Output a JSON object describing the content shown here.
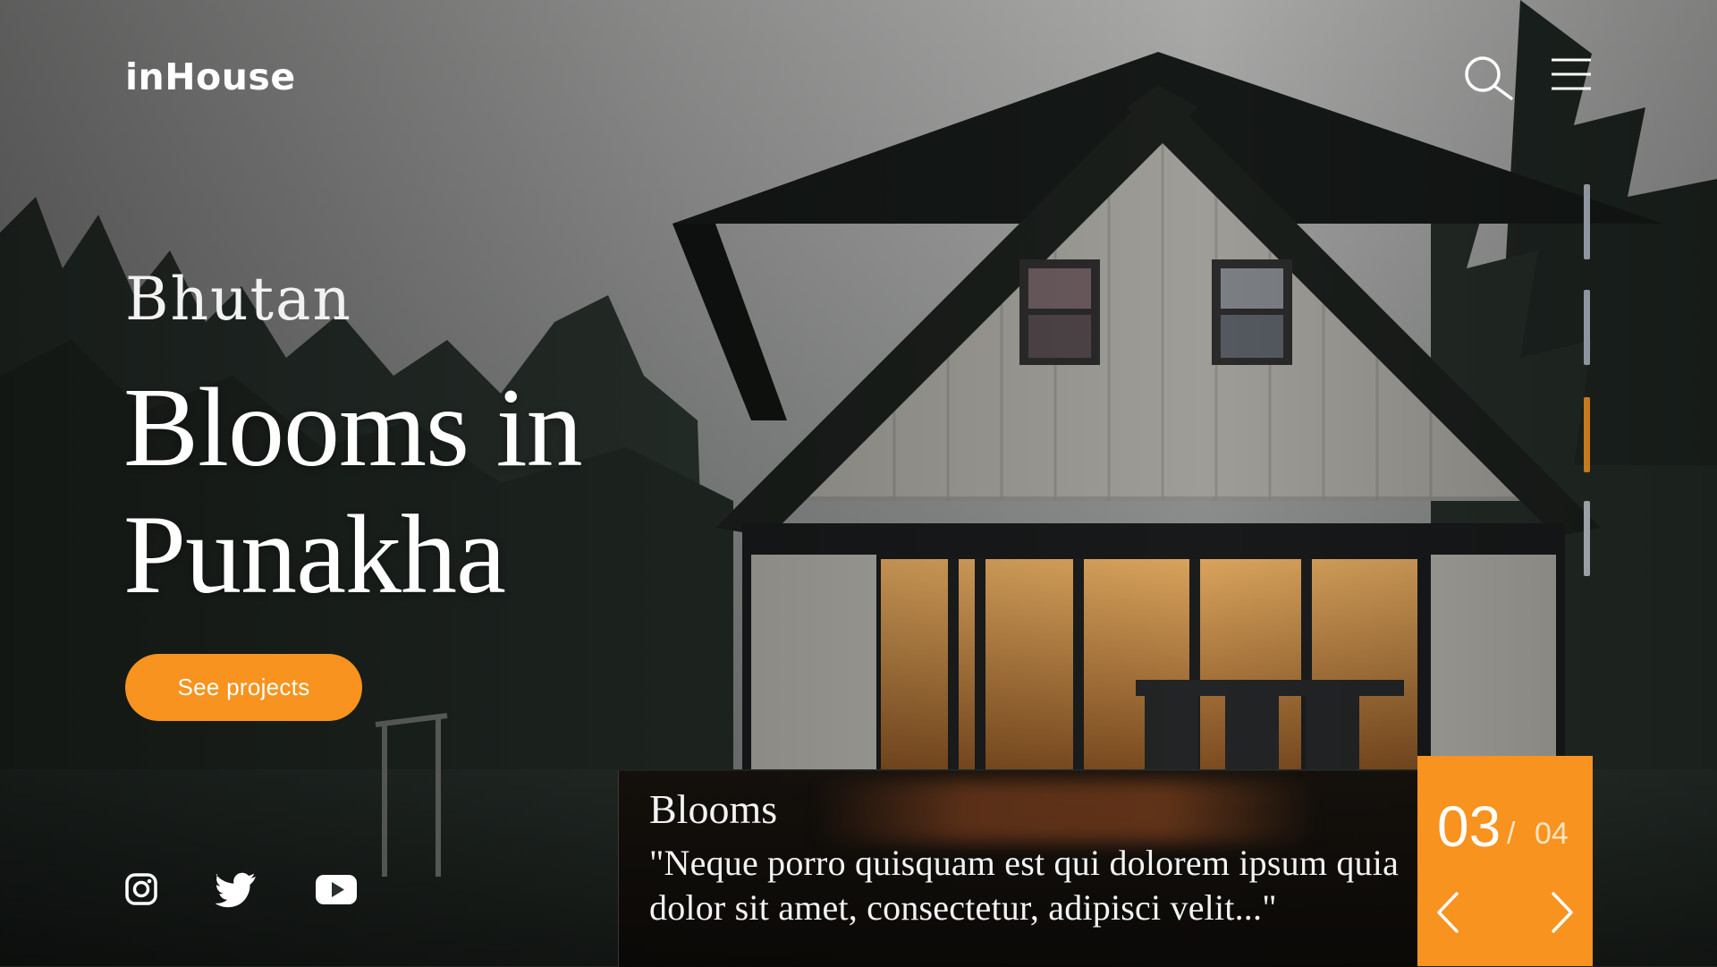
{
  "header": {
    "logo": "inHouse",
    "search_icon": "search-icon",
    "menu_icon": "hamburger-menu-icon"
  },
  "hero": {
    "kicker": "Bhutan",
    "headline_line1": "Blooms in",
    "headline_line2": "Punakha",
    "cta_label": "See projects"
  },
  "slide_indicator": {
    "segments": 4,
    "active_index": 3,
    "active_color": "#c67a1c",
    "inactive_color": "#8f959e"
  },
  "social": {
    "icons": [
      "instagram-icon",
      "twitter-icon",
      "youtube-icon"
    ]
  },
  "info_card": {
    "title": "Blooms",
    "quote": "\"Neque porro quisquam est qui dolorem ipsum quia dolor sit amet, consectetur, adipisci velit...\""
  },
  "counter": {
    "current": "03",
    "separator": "/",
    "total": "04",
    "prev_icon": "chevron-left-icon",
    "next_icon": "chevron-right-icon"
  },
  "colors": {
    "accent": "#f7931e",
    "text": "#ffffff"
  }
}
